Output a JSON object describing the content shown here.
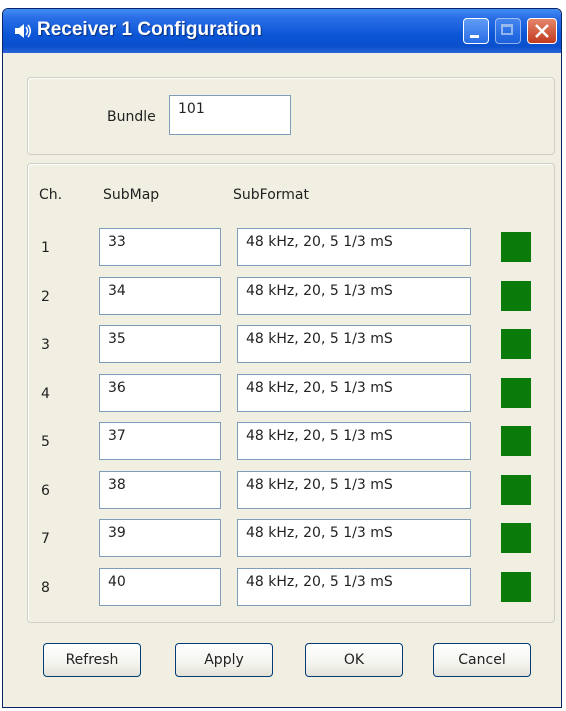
{
  "window": {
    "title": "Receiver 1 Configuration"
  },
  "bundle": {
    "label": "Bundle",
    "value": "101"
  },
  "table": {
    "headers": {
      "channel": "Ch.",
      "submap": "SubMap",
      "subformat": "SubFormat"
    },
    "rows": [
      {
        "ch": "1",
        "submap": "33",
        "subformat": "48 kHz, 20, 5 1/3 mS",
        "status": "#0a7a0a"
      },
      {
        "ch": "2",
        "submap": "34",
        "subformat": "48 kHz, 20, 5 1/3 mS",
        "status": "#0a7a0a"
      },
      {
        "ch": "3",
        "submap": "35",
        "subformat": "48 kHz, 20, 5 1/3 mS",
        "status": "#0a7a0a"
      },
      {
        "ch": "4",
        "submap": "36",
        "subformat": "48 kHz, 20, 5 1/3 mS",
        "status": "#0a7a0a"
      },
      {
        "ch": "5",
        "submap": "37",
        "subformat": "48 kHz, 20, 5 1/3 mS",
        "status": "#0a7a0a"
      },
      {
        "ch": "6",
        "submap": "38",
        "subformat": "48 kHz, 20, 5 1/3 mS",
        "status": "#0a7a0a"
      },
      {
        "ch": "7",
        "submap": "39",
        "subformat": "48 kHz, 20, 5 1/3 mS",
        "status": "#0a7a0a"
      },
      {
        "ch": "8",
        "submap": "40",
        "subformat": "48 kHz, 20, 5 1/3 mS",
        "status": "#0a7a0a"
      }
    ]
  },
  "buttons": {
    "refresh": "Refresh",
    "apply": "Apply",
    "ok": "OK",
    "cancel": "Cancel"
  },
  "icons": {
    "app": "speaker-icon",
    "minimize": "minimize-icon",
    "maximize": "maximize-icon",
    "close": "close-icon"
  },
  "colors": {
    "titlebar": "#0b56d6",
    "status_ok": "#0a7a0a",
    "window_bg": "#f1efe2"
  }
}
